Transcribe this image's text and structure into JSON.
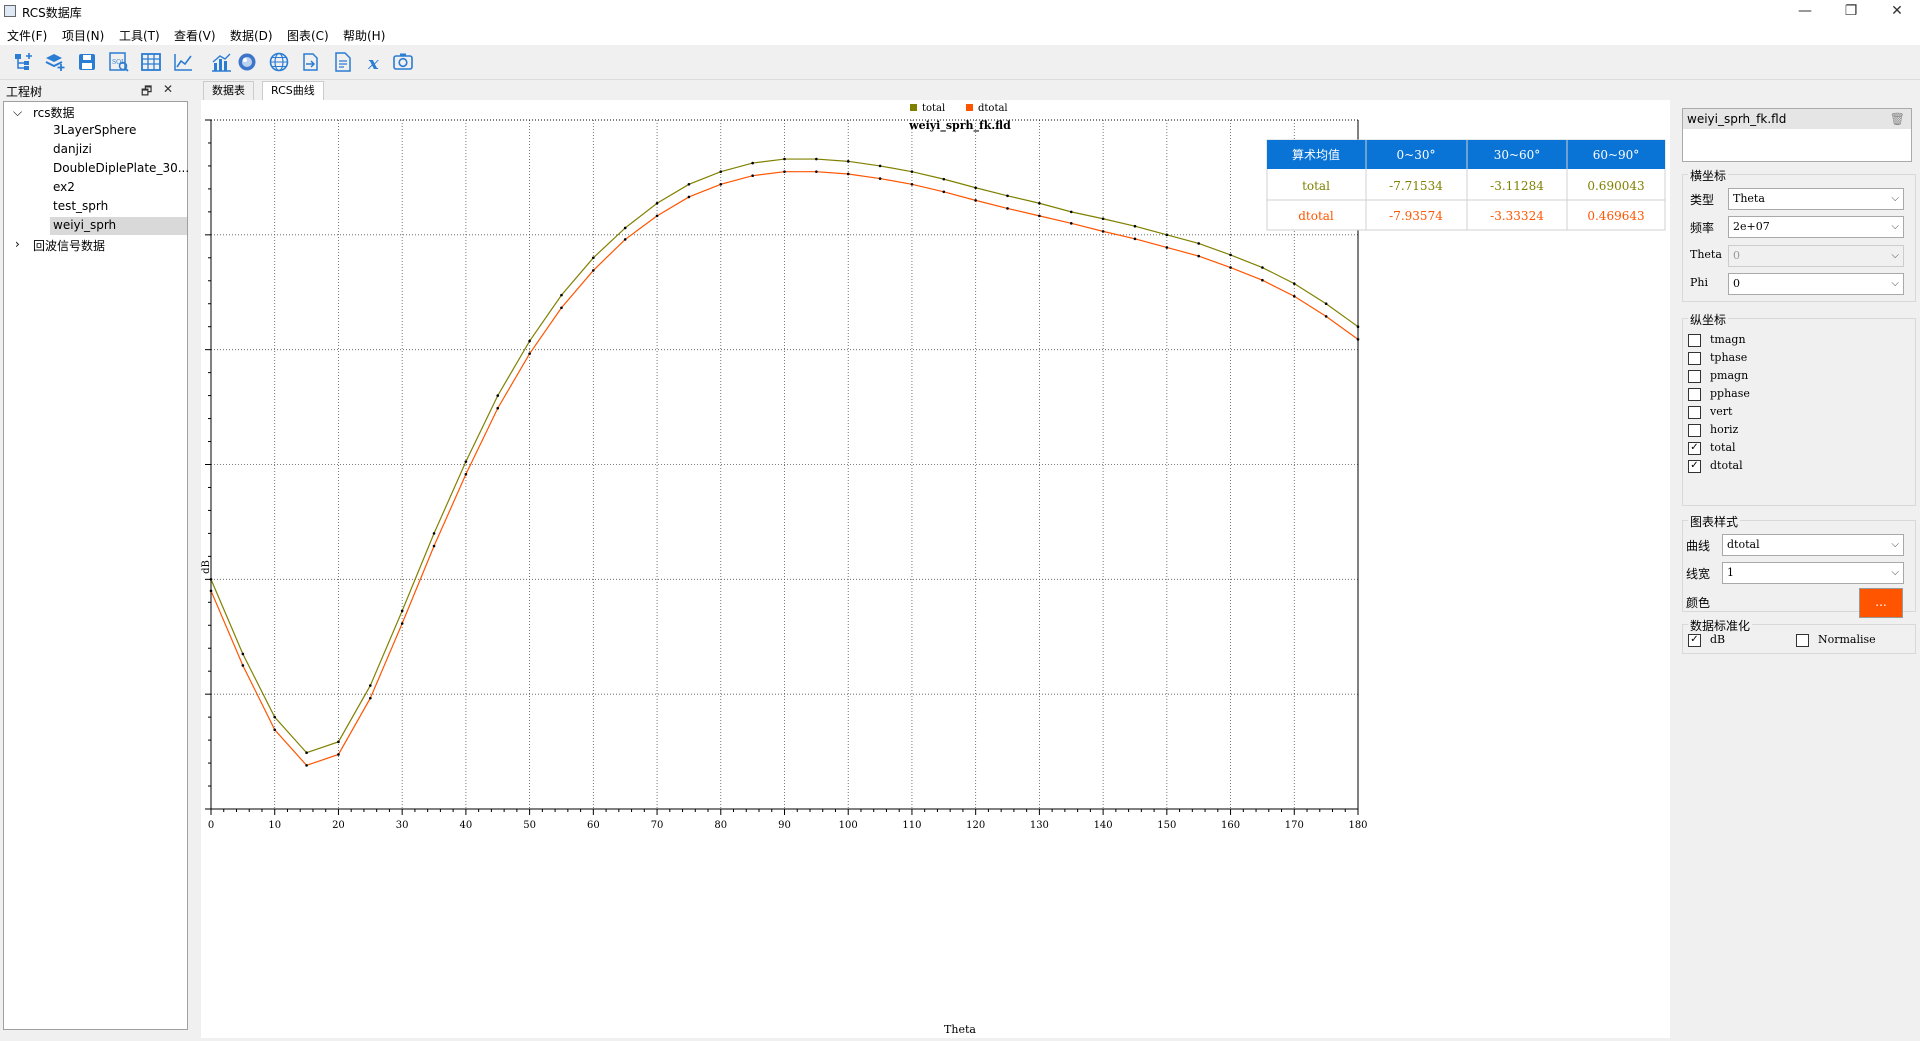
{
  "app": {
    "title": "RCS数据库"
  },
  "menu": [
    {
      "label": "文件(F)"
    },
    {
      "label": "项目(N)"
    },
    {
      "label": "工具(T)"
    },
    {
      "label": "查看(V)"
    },
    {
      "label": "数据(D)"
    },
    {
      "label": "图表(C)"
    },
    {
      "label": "帮助(H)"
    }
  ],
  "toolbar_icons": [
    "add-tree-icon",
    "layers-add-icon",
    "save-icon",
    "sql-search-icon",
    "table-icon",
    "line-chart-icon",
    "bar-chart-icon",
    "orb-icon",
    "globe-icon",
    "export-icon",
    "document-export-icon",
    "formula-x-icon",
    "camera-icon"
  ],
  "dock": {
    "title": "工程树"
  },
  "tree": {
    "root": "rcs数据",
    "children": [
      "3LayerSphere",
      "danjizi",
      "DoubleDiplePlate_30...",
      "ex2",
      "test_sprh",
      "weiyi_sprh"
    ],
    "selected": "weiyi_sprh",
    "second_root": "回波信号数据"
  },
  "tabs": [
    {
      "label": "数据表"
    },
    {
      "label": "RCS曲线"
    }
  ],
  "stats_table": {
    "headers": [
      "算术均值",
      "0~30°",
      "30~60°",
      "60~90°"
    ],
    "rows": [
      {
        "name": "total",
        "v1": "-7.71534",
        "v2": "-3.11284",
        "v3": "0.690043"
      },
      {
        "name": "dtotal",
        "v1": "-7.93574",
        "v2": "-3.33324",
        "v3": "0.469643"
      }
    ]
  },
  "right_panel": {
    "file_name": "weiyi_sprh_fk.fld",
    "x_axis": {
      "title": "横坐标",
      "type_label": "类型",
      "type_value": "Theta",
      "freq_label": "频率",
      "freq_value": "2e+07",
      "theta_label": "Theta",
      "theta_value": "0",
      "phi_label": "Phi",
      "phi_value": "0"
    },
    "y_axis": {
      "title": "纵坐标",
      "items": [
        {
          "label": "tmagn",
          "checked": false
        },
        {
          "label": "tphase",
          "checked": false
        },
        {
          "label": "pmagn",
          "checked": false
        },
        {
          "label": "pphase",
          "checked": false
        },
        {
          "label": "vert",
          "checked": false
        },
        {
          "label": "horiz",
          "checked": false
        },
        {
          "label": "total",
          "checked": true
        },
        {
          "label": "dtotal",
          "checked": true
        }
      ]
    },
    "style": {
      "title": "图表样式",
      "curve_label": "曲线",
      "curve_value": "dtotal",
      "width_label": "线宽",
      "width_value": "1",
      "color_label": "颜色",
      "color_value": "#ff5500",
      "color_button_text": "..."
    },
    "normalize": {
      "title": "数据标准化",
      "db_label": "dB",
      "db_checked": true,
      "norm_label": "Normalise",
      "norm_checked": false
    }
  },
  "chart_data": {
    "type": "line",
    "title": "weiyi_sprh_fk.fld",
    "xlabel": "Theta",
    "ylabel": "dB",
    "xlim": [
      0,
      180
    ],
    "ylim": [
      -10,
      2
    ],
    "xticks": [
      0,
      10,
      20,
      30,
      40,
      50,
      60,
      70,
      80,
      90,
      100,
      110,
      120,
      130,
      140,
      150,
      160,
      170,
      180
    ],
    "yticks": [
      -10,
      -8,
      -6,
      -4,
      -2,
      0,
      2
    ],
    "grid": true,
    "legend": "top-center",
    "x": [
      0,
      5,
      10,
      15,
      20,
      25,
      30,
      35,
      40,
      45,
      50,
      55,
      60,
      65,
      70,
      75,
      80,
      85,
      90,
      95,
      100,
      105,
      110,
      115,
      120,
      125,
      130,
      135,
      140,
      145,
      150,
      155,
      160,
      165,
      170,
      175,
      180
    ],
    "series": [
      {
        "name": "total",
        "color": "#808000",
        "values": [
          -6.0,
          -7.3,
          -8.4,
          -9.02,
          -8.83,
          -7.85,
          -6.55,
          -5.2,
          -3.95,
          -2.8,
          -1.85,
          -1.05,
          -0.4,
          0.12,
          0.55,
          0.88,
          1.1,
          1.25,
          1.32,
          1.32,
          1.28,
          1.2,
          1.1,
          0.97,
          0.82,
          0.68,
          0.55,
          0.4,
          0.28,
          0.15,
          0.0,
          -0.15,
          -0.35,
          -0.57,
          -0.85,
          -1.2,
          -1.6
        ]
      },
      {
        "name": "dtotal",
        "color": "#ff5500",
        "values": [
          -6.2,
          -7.5,
          -8.62,
          -9.24,
          -9.05,
          -8.07,
          -6.77,
          -5.42,
          -4.17,
          -3.02,
          -2.07,
          -1.27,
          -0.62,
          -0.08,
          0.33,
          0.66,
          0.88,
          1.03,
          1.1,
          1.1,
          1.06,
          0.98,
          0.88,
          0.75,
          0.6,
          0.46,
          0.33,
          0.2,
          0.06,
          -0.07,
          -0.22,
          -0.37,
          -0.57,
          -0.79,
          -1.07,
          -1.42,
          -1.82
        ]
      }
    ]
  }
}
